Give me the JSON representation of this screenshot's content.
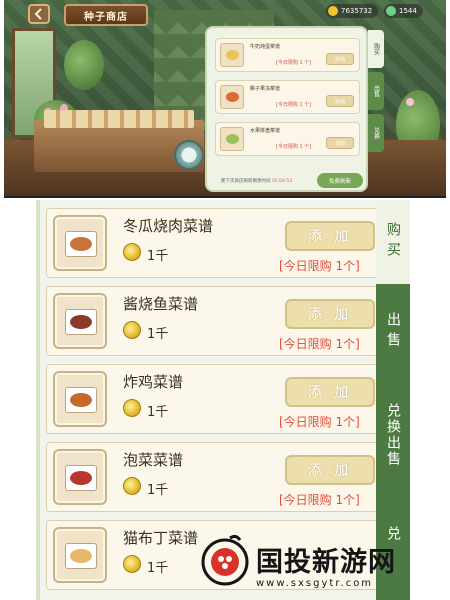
{
  "top": {
    "title": "种子商店",
    "currency": [
      {
        "icon": "gold-coin-icon",
        "value": "7635732",
        "color": "#f2c232"
      },
      {
        "icon": "gem-icon",
        "value": "1544",
        "color": "#6fd08a"
      }
    ],
    "mini_shop": {
      "items": [
        {
          "name": "牛奶炖蛋菜谱",
          "limit": "[今日限购 1 个]",
          "button": "添加"
        },
        {
          "name": "椰子果冻菜谱",
          "limit": "[今日限购 1 个]",
          "button": "添加"
        },
        {
          "name": "水果拼盘菜谱",
          "limit": "[今日限购 1 个]",
          "button": "添加"
        }
      ],
      "footer_text": "距下次商店刷新剩余时间",
      "footer_time": "05:04:53",
      "refresh_button": "免费刷新",
      "tabs": [
        "购买",
        "出售",
        "兑换"
      ]
    }
  },
  "shop": {
    "items": [
      {
        "name": "冬瓜烧肉菜谱",
        "price": "1千",
        "button": "添 加",
        "limit": "[今日限购  1个]",
        "food_color": "#c9743c"
      },
      {
        "name": "酱烧鱼菜谱",
        "price": "1千",
        "button": "添 加",
        "limit": "[今日限购  1个]",
        "food_color": "#8a3a2a"
      },
      {
        "name": "炸鸡菜谱",
        "price": "1千",
        "button": "添 加",
        "limit": "[今日限购  1个]",
        "food_color": "#c46a2a"
      },
      {
        "name": "泡菜菜谱",
        "price": "1千",
        "button": "添 加",
        "limit": "[今日限购  1个]",
        "food_color": "#b8382e"
      },
      {
        "name": "猫布丁菜谱",
        "price": "1千",
        "food_color": "#e7b86a"
      }
    ],
    "tabs": [
      {
        "label": "购买"
      },
      {
        "label": "出售"
      },
      {
        "label": "兑换出售"
      },
      {
        "label": "兑"
      }
    ]
  },
  "watermark": {
    "title": "国投新游网",
    "url": "www.sxsgytr.com"
  }
}
